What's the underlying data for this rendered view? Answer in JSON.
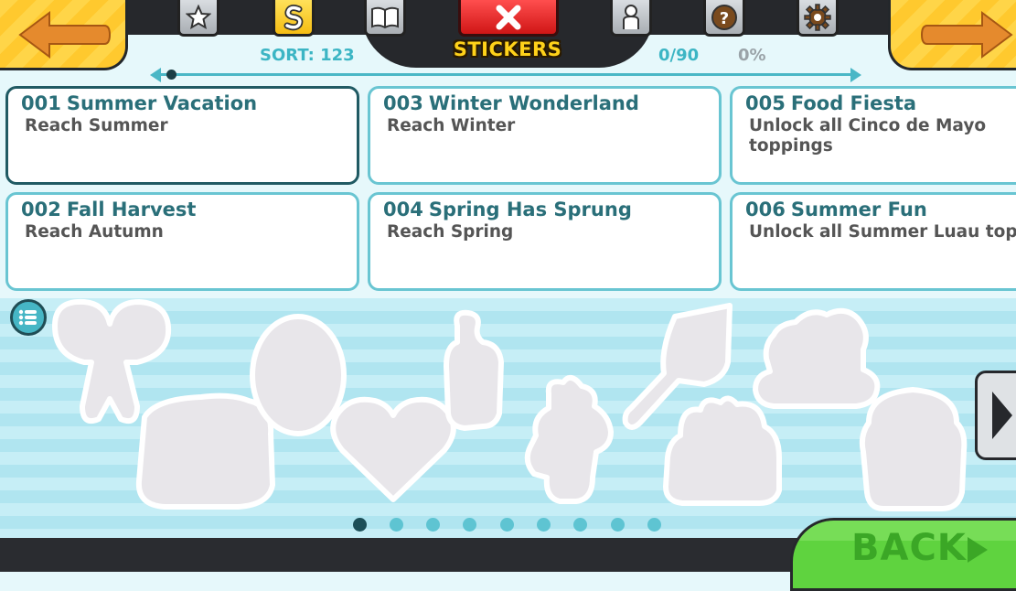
{
  "header": {
    "title": "STICKERS",
    "sort": "SORT: 123",
    "progress_count": "0/90",
    "progress_percent": "0%",
    "progress_fraction": 0
  },
  "tabs": [
    {
      "icon": "star-icon"
    },
    {
      "icon": "sticker-s-icon",
      "active": true
    },
    {
      "icon": "book-icon"
    },
    {
      "icon": "close-icon"
    },
    {
      "icon": "customer-icon"
    },
    {
      "icon": "help-icon"
    },
    {
      "icon": "gear-icon"
    }
  ],
  "cards": [
    {
      "num": "001",
      "title": "Summer Vacation",
      "desc": "Reach Summer",
      "selected": true
    },
    {
      "num": "002",
      "title": "Fall Harvest",
      "desc": "Reach Autumn"
    },
    {
      "num": "003",
      "title": "Winter Wonderland",
      "desc": "Reach Winter"
    },
    {
      "num": "004",
      "title": "Spring Has Sprung",
      "desc": "Reach Spring"
    },
    {
      "num": "005",
      "title": "Food Fiesta",
      "desc": "Unlock all Cinco de Mayo toppings"
    },
    {
      "num": "006",
      "title": "Summer Fun",
      "desc": "Unlock all Summer Luau toppings"
    }
  ],
  "pagination": {
    "pages": 9,
    "current": 1
  },
  "back_button": {
    "label": "BACK"
  },
  "colors": {
    "accent": "#4ab7c6",
    "dark": "#26282c",
    "gold": "#ffd21a",
    "green": "#5fd33f"
  }
}
